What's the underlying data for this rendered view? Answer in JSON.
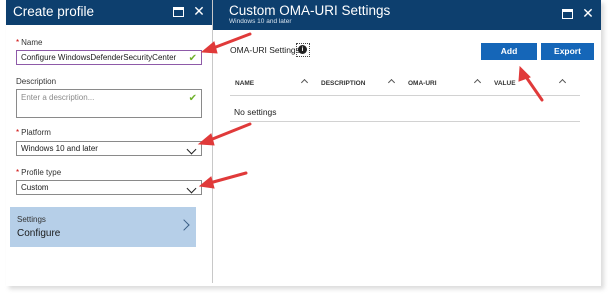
{
  "left_blade": {
    "title": "Create profile",
    "fields": {
      "name": {
        "label": "Name",
        "required": true,
        "value": "Configure WindowsDefenderSecurityCenter",
        "valid": true
      },
      "description": {
        "label": "Description",
        "required": false,
        "placeholder": "Enter a description...",
        "valid": true
      },
      "platform": {
        "label": "Platform",
        "required": true,
        "value": "Windows 10 and later"
      },
      "profile_type": {
        "label": "Profile type",
        "required": true,
        "value": "Custom"
      }
    },
    "settings_tile": {
      "label": "Settings",
      "value": "Configure"
    }
  },
  "right_blade": {
    "title": "Custom OMA-URI Settings",
    "subtitle": "Windows 10 and later",
    "section_label": "OMA-URI Settings",
    "buttons": {
      "add": "Add",
      "export": "Export"
    },
    "table": {
      "columns": [
        "NAME",
        "DESCRIPTION",
        "OMA-URI",
        "VALUE"
      ],
      "empty_text": "No settings"
    }
  },
  "colors": {
    "header": "#0d3f6e",
    "button": "#1566b8",
    "tile": "#b6cfe8",
    "annotation_arrow": "#e03a3a",
    "check": "#6fb22b"
  },
  "icons": [
    "maximize-icon",
    "close-icon",
    "checkmark-icon",
    "chevron-down-icon",
    "chevron-right-icon",
    "info-icon",
    "sort-caret-icon"
  ]
}
